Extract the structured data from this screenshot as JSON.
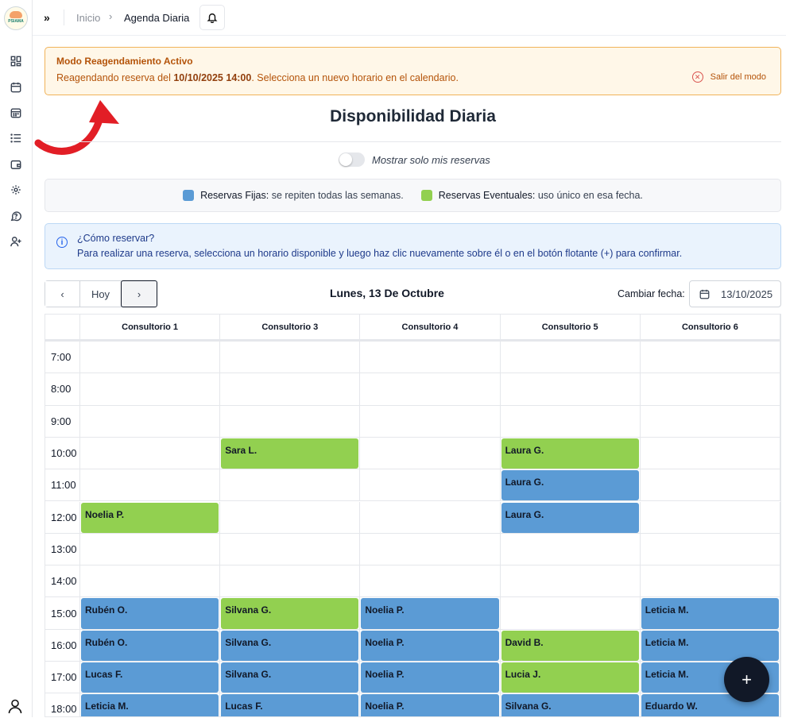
{
  "logo": {
    "text": "PSIAMA"
  },
  "topbar": {
    "collapse": "»",
    "breadcrumb": {
      "home": "Inicio",
      "separator": "›",
      "current": "Agenda Diaria"
    }
  },
  "banner": {
    "title": "Modo Reagendamiento Activo",
    "msg_prefix": "Reagendando reserva del ",
    "msg_date": "10/10/2025 14:00",
    "msg_suffix": ". Selecciona un nuevo horario en el calendario.",
    "exit_label": "Salir del modo"
  },
  "page_title": "Disponibilidad Diaria",
  "toggle": {
    "label": "Mostrar solo mis reservas",
    "on": false
  },
  "legend": {
    "fixed_label": "Reservas Fijas:",
    "fixed_desc": "se repiten todas las semanas.",
    "event_label": "Reservas Eventuales:",
    "event_desc": "uso único en esa fecha."
  },
  "info": {
    "title": "¿Cómo reservar?",
    "text": "Para realizar una reserva, selecciona un horario disponible y luego haz clic nuevamente sobre él o en el botón flotante (+) para confirmar."
  },
  "nav": {
    "prev": "‹",
    "today": "Hoy",
    "next": "›"
  },
  "date_label": "Lunes, 13 De Octubre",
  "change_date": {
    "label": "Cambiar fecha:",
    "value": "13/10/2025"
  },
  "colors": {
    "fixed": "#5b9bd5",
    "event": "#92d050",
    "banner_border": "#f0b35a"
  },
  "schedule": {
    "rooms": [
      "Consultorio 1",
      "Consultorio 3",
      "Consultorio 4",
      "Consultorio 5",
      "Consultorio 6"
    ],
    "times": [
      "7:00",
      "8:00",
      "9:00",
      "10:00",
      "11:00",
      "12:00",
      "13:00",
      "14:00",
      "15:00",
      "16:00",
      "17:00",
      "18:00"
    ],
    "reservations": [
      {
        "time": "10:00",
        "room": 1,
        "name": "Sara L.",
        "type": "event"
      },
      {
        "time": "10:00",
        "room": 3,
        "name": "Laura G.",
        "type": "event"
      },
      {
        "time": "11:00",
        "room": 3,
        "name": "Laura G.",
        "type": "fixed"
      },
      {
        "time": "12:00",
        "room": 0,
        "name": "Noelia P.",
        "type": "event"
      },
      {
        "time": "12:00",
        "room": 3,
        "name": "Laura G.",
        "type": "fixed"
      },
      {
        "time": "15:00",
        "room": 0,
        "name": "Rubén O.",
        "type": "fixed"
      },
      {
        "time": "15:00",
        "room": 1,
        "name": "Silvana G.",
        "type": "event"
      },
      {
        "time": "15:00",
        "room": 2,
        "name": "Noelia P.",
        "type": "fixed"
      },
      {
        "time": "15:00",
        "room": 4,
        "name": "Leticia M.",
        "type": "fixed"
      },
      {
        "time": "16:00",
        "room": 0,
        "name": "Rubén O.",
        "type": "fixed"
      },
      {
        "time": "16:00",
        "room": 1,
        "name": "Silvana G.",
        "type": "fixed"
      },
      {
        "time": "16:00",
        "room": 2,
        "name": "Noelia P.",
        "type": "fixed"
      },
      {
        "time": "16:00",
        "room": 3,
        "name": "David B.",
        "type": "event"
      },
      {
        "time": "16:00",
        "room": 4,
        "name": "Leticia M.",
        "type": "fixed"
      },
      {
        "time": "17:00",
        "room": 0,
        "name": "Lucas F.",
        "type": "fixed"
      },
      {
        "time": "17:00",
        "room": 1,
        "name": "Silvana G.",
        "type": "fixed"
      },
      {
        "time": "17:00",
        "room": 2,
        "name": "Noelia P.",
        "type": "fixed"
      },
      {
        "time": "17:00",
        "room": 3,
        "name": "Lucia J.",
        "type": "event"
      },
      {
        "time": "17:00",
        "room": 4,
        "name": "Leticia M.",
        "type": "fixed"
      },
      {
        "time": "18:00",
        "room": 0,
        "name": "Leticia M.",
        "type": "fixed"
      },
      {
        "time": "18:00",
        "room": 1,
        "name": "Lucas F.",
        "type": "fixed"
      },
      {
        "time": "18:00",
        "room": 2,
        "name": "Noelia P.",
        "type": "fixed"
      },
      {
        "time": "18:00",
        "room": 3,
        "name": "Silvana G.",
        "type": "fixed"
      },
      {
        "time": "18:00",
        "room": 4,
        "name": "Eduardo W.",
        "type": "fixed"
      }
    ]
  },
  "fab": {
    "label": "+"
  }
}
